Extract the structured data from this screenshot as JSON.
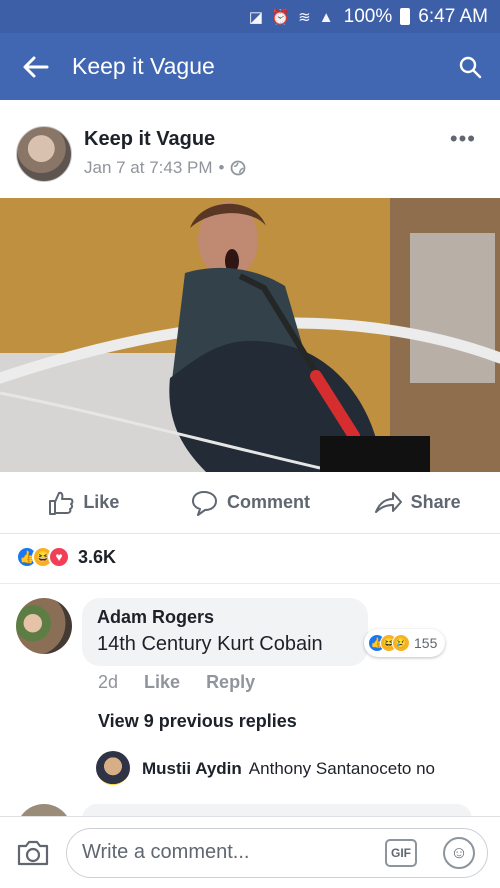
{
  "status": {
    "time": "6:47 AM",
    "battery": "100%",
    "icons": "◪ ⏰ ≋ ▲"
  },
  "header": {
    "title": "Keep it Vague",
    "back_icon": "back-arrow-icon",
    "search_icon": "search-icon"
  },
  "post": {
    "page_name": "Keep it Vague",
    "timestamp": "Jan 7 at 7:43 PM",
    "privacy": "•",
    "more": "•••",
    "photo_description": "photo-placeholder"
  },
  "actions": {
    "like": "Like",
    "comment": "Comment",
    "share": "Share"
  },
  "reactions": {
    "count": "3.6K",
    "icons": [
      "like-reaction",
      "haha-reaction",
      "love-reaction"
    ]
  },
  "comment": {
    "author": "Adam Rogers",
    "text": "14th Century Kurt Cobain",
    "age": "2d",
    "like": "Like",
    "reply": "Reply",
    "reaction_count": "155",
    "view_replies": "View 9 previous replies"
  },
  "reply": {
    "author": "Mustii Aydin",
    "text": "Anthony Santanoceto no"
  },
  "composer": {
    "placeholder": "Write a comment...",
    "gif_label": "GIF"
  },
  "colors": {
    "brand": "#4267b2",
    "status": "#3d5fa8",
    "like": "#1877f2",
    "love": "#f33e58",
    "haha": "#f7b125"
  }
}
